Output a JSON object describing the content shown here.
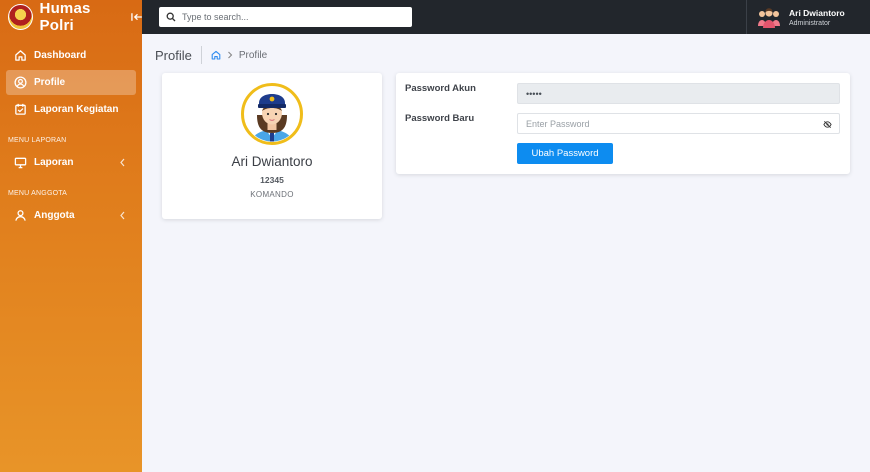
{
  "brand": {
    "name": "Humas Polri"
  },
  "sidebar": {
    "items": [
      {
        "label": "Dashboard"
      },
      {
        "label": "Profile"
      },
      {
        "label": "Laporan Kegiatan"
      }
    ],
    "section_laporan": "MENU LAPORAN",
    "laporan": {
      "label": "Laporan"
    },
    "section_anggota": "MENU ANGGOTA",
    "anggota": {
      "label": "Anggota"
    }
  },
  "search": {
    "placeholder": "Type to search..."
  },
  "user": {
    "name": "Ari Dwiantoro",
    "role": "Administrator"
  },
  "page": {
    "title": "Profile",
    "breadcrumb_current": "Profile"
  },
  "profile": {
    "name": "Ari Dwiantoro",
    "nrp": "12345",
    "unit": "KOMANDO"
  },
  "password_form": {
    "account_label": "Password Akun",
    "account_value": "•••••",
    "new_label": "Password Baru",
    "new_placeholder": "Enter Password",
    "submit_label": "Ubah Password"
  },
  "colors": {
    "sidebar_top": "#d86a14",
    "sidebar_bottom": "#e89428",
    "topbar": "#22262c",
    "primary_button": "#0d8cf0"
  }
}
